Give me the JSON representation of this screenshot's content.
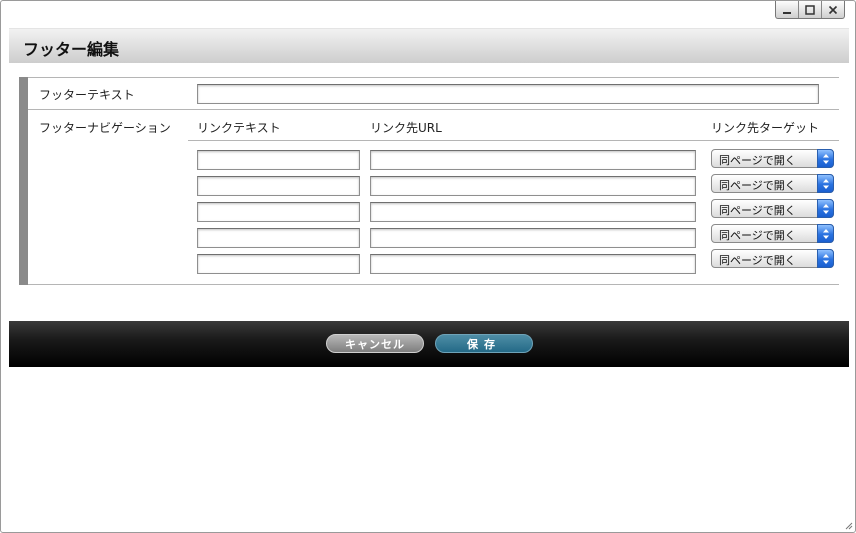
{
  "window": {
    "title": "フッター編集",
    "controls": [
      {
        "name": "minimize-button",
        "icon": "minimize-icon"
      },
      {
        "name": "maximize-button",
        "icon": "maximize-icon"
      },
      {
        "name": "close-button",
        "icon": "close-icon"
      }
    ]
  },
  "form": {
    "footer_text_label": "フッターテキスト",
    "footer_text_value": "",
    "nav_label": "フッターナビゲーション",
    "columns": {
      "link_text": "リンクテキスト",
      "link_url": "リンク先URL",
      "link_target": "リンク先ターゲット"
    },
    "rows": [
      {
        "text": "",
        "url": "",
        "target": "同ページで開く"
      },
      {
        "text": "",
        "url": "",
        "target": "同ページで開く"
      },
      {
        "text": "",
        "url": "",
        "target": "同ページで開く"
      },
      {
        "text": "",
        "url": "",
        "target": "同ページで開く"
      },
      {
        "text": "",
        "url": "",
        "target": "同ページで開く"
      }
    ]
  },
  "actions": {
    "cancel_label": "キャンセル",
    "save_label": "保存"
  },
  "colors": {
    "select_arrow_blue": "#2b73e0",
    "save_button": "#246a87",
    "cancel_button": "#7e7e7e",
    "footer_bar": "#000000"
  }
}
